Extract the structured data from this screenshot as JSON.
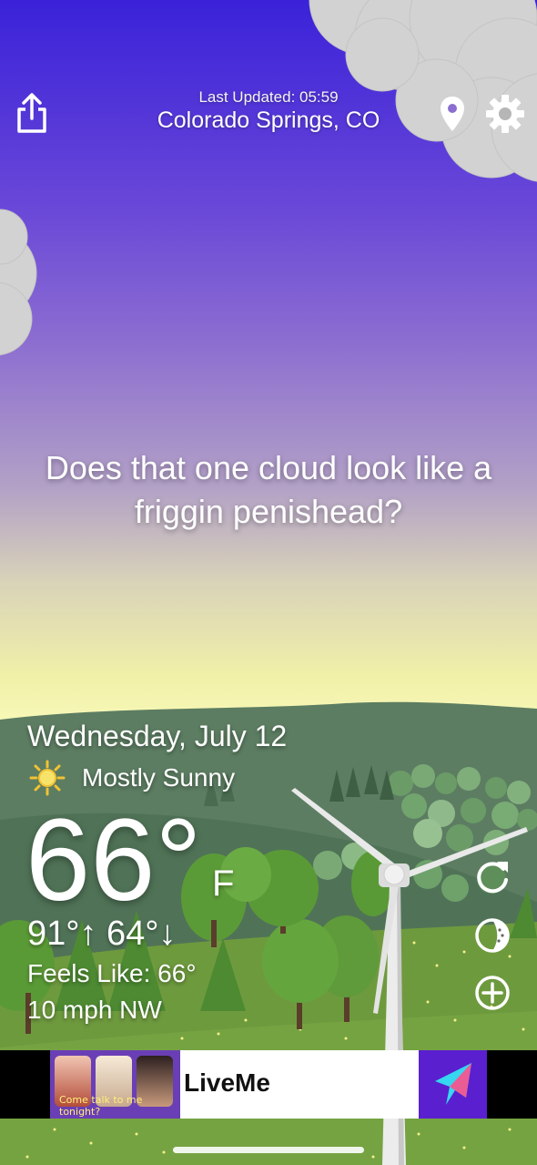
{
  "header": {
    "last_updated": "Last Updated: 05:59",
    "location": "Colorado Springs, CO"
  },
  "icons": {
    "share": "share-icon",
    "location": "location-pin-icon",
    "settings": "gear-icon",
    "condition": "sun-icon",
    "refresh": "refresh-icon",
    "theme": "palette-icon",
    "add": "plus-circle-icon"
  },
  "message": "Does that one cloud look like a friggin penishead?",
  "weather": {
    "date": "Wednesday, July 12",
    "condition": "Mostly Sunny",
    "temperature": "66°",
    "unit": "F",
    "high_low": "91°↑ 64°↓",
    "feels_like": "Feels Like: 66°",
    "wind": "10 mph NW"
  },
  "ad": {
    "caption": "Come talk to me tonight?",
    "title": "LiveMe"
  },
  "colors": {
    "sky_top": "#3a22d9",
    "horizon": "#f8f8b8",
    "hills": "#5b7a5f",
    "grass": "#6e9a3e",
    "ad_purple": "#5a1fcf"
  }
}
